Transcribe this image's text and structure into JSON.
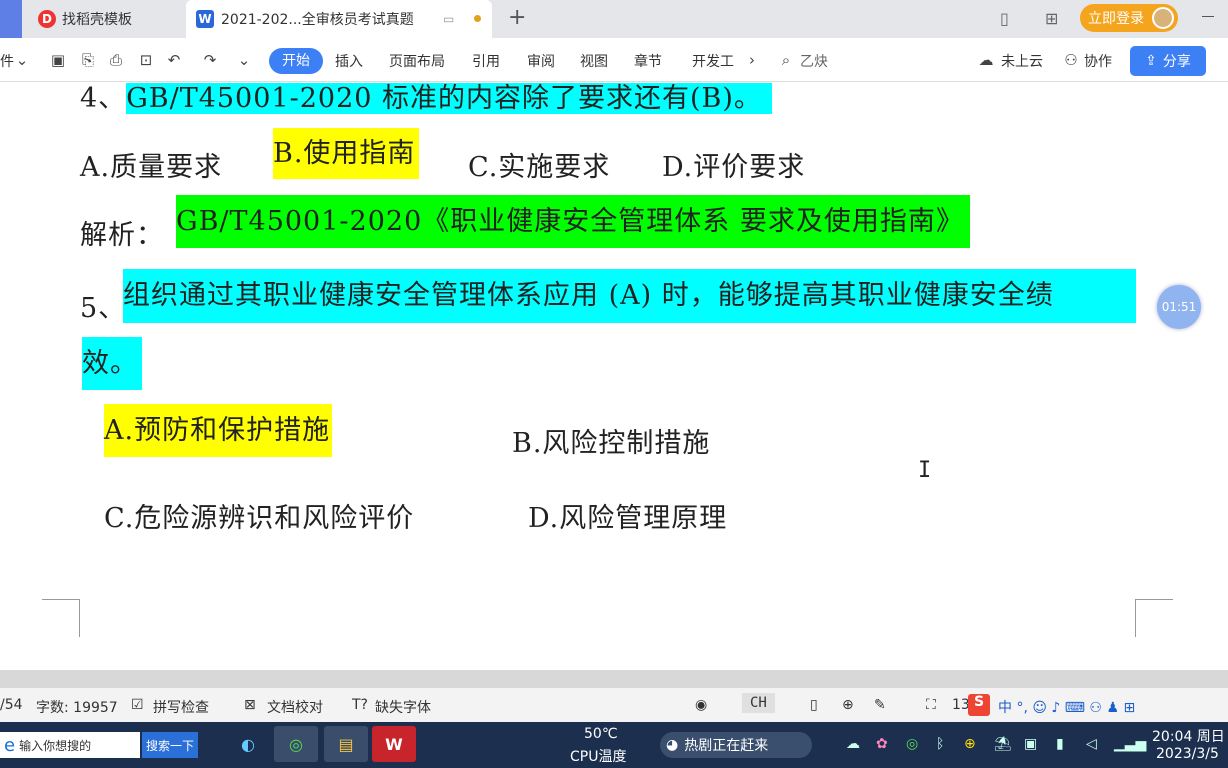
{
  "tabs": [
    {
      "label": "找稻壳模板"
    },
    {
      "label": "2021-202...全审核员考试真题"
    }
  ],
  "header": {
    "login_label": "立即登录"
  },
  "ribbon": {
    "left_cut": "件",
    "tabs": [
      "开始",
      "插入",
      "页面布局",
      "引用",
      "审阅",
      "视图",
      "章节",
      "开发工"
    ],
    "search_placeholder": "乙炔",
    "cloud_label": "未上云",
    "collab_label": "协作",
    "share_label": "分享"
  },
  "document": {
    "q4_prefix": "4、",
    "q4_text": "GB/T45001-2020 标准的内容除了要求还有(B)。",
    "q4_opt_a": "A.质量要求",
    "q4_opt_b": "B.使用指南",
    "q4_opt_c": "C.实施要求",
    "q4_opt_d": "D.评价要求",
    "analysis_label": "解析：",
    "analysis_text": "GB/T45001-2020《职业健康安全管理体系 要求及使用指南》",
    "q5_prefix": "5、",
    "q5_text_line1": "组织通过其职业健康安全管理体系应用 (A) 时，能够提高其职业健康安全绩",
    "q5_text_line2": "效。",
    "q5_opt_a": "A.预防和保护措施",
    "q5_opt_b": "B.风险控制措施",
    "q5_opt_c": "C.危险源辨识和风险评价",
    "q5_opt_d": "D.风险管理原理",
    "timer": "01:51"
  },
  "status": {
    "page": "/54",
    "word_count": "字数: 19957",
    "spell_check": "拼写检查",
    "doc_proof": "文档校对",
    "missing_font": "缺失字体",
    "ime": "CH",
    "zoom": "13"
  },
  "taskbar": {
    "search_placeholder": "输入你想搜的",
    "search_button": "搜索一下",
    "cpu_temp": "50℃",
    "cpu_label": "CPU温度",
    "hot_news": "热剧正在赶来",
    "time": "20:04 周日",
    "date": "2023/3/5"
  },
  "colors": {
    "accent": "#3d7ff5",
    "highlight_cyan": "#00ffff",
    "highlight_yellow": "#ffff00",
    "highlight_green": "#00ff00",
    "login_orange": "#f4a51d",
    "taskbar": "#1c2f4f"
  }
}
